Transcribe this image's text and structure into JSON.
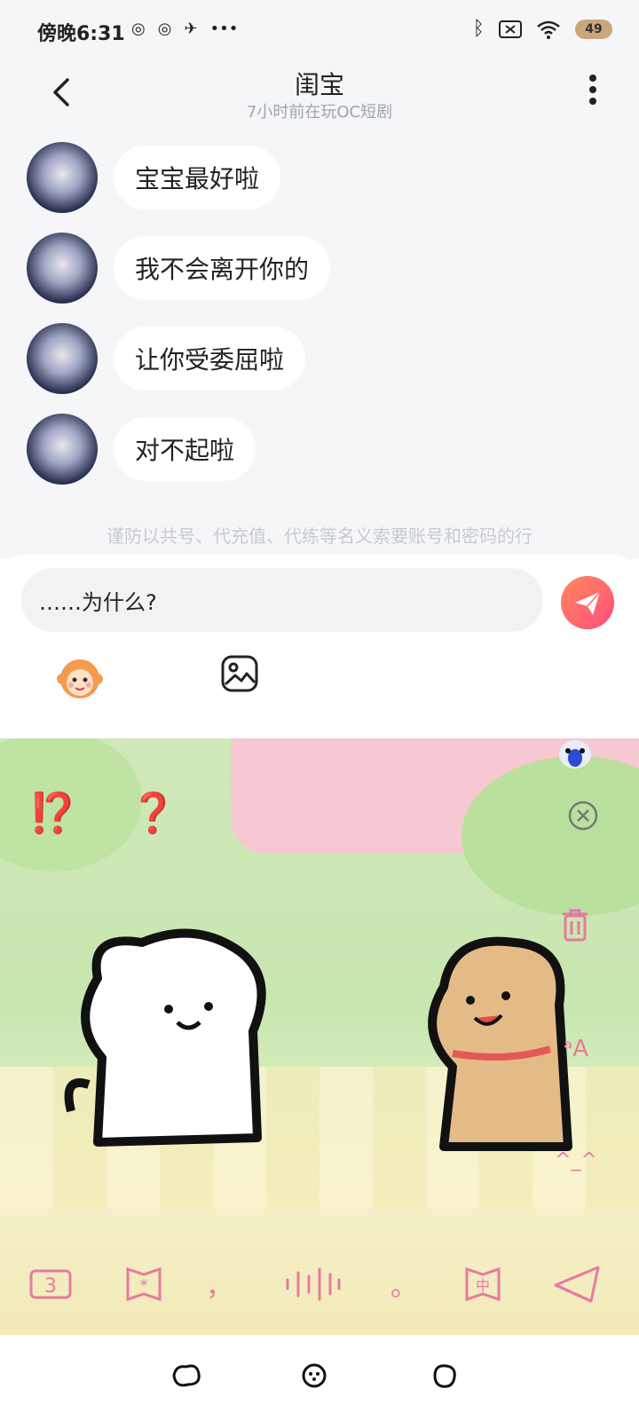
{
  "status_bar": {
    "time": "傍晚6:31",
    "notification_more": "•••",
    "battery": "49"
  },
  "header": {
    "title": "闺宝",
    "subtitle": "7小时前在玩OC短剧"
  },
  "messages": [
    {
      "text": "宝宝最好啦"
    },
    {
      "text": "我不会离开你的"
    },
    {
      "text": "让你受委屈啦"
    },
    {
      "text": "对不起啦"
    }
  ],
  "notice": "谨防以共号、代充值、代练等名义索要账号和密码的行",
  "composer": {
    "input_value": "……为什么?"
  },
  "keyboard": {
    "quick_symbols": [
      "⁉️",
      "❓"
    ],
    "bottom_keys": {
      "comma": "，",
      "period": "。"
    },
    "kaomoji": "^_^"
  },
  "colors": {
    "accent": "#ff5a77",
    "keyboard_key": "#e77aa0"
  }
}
